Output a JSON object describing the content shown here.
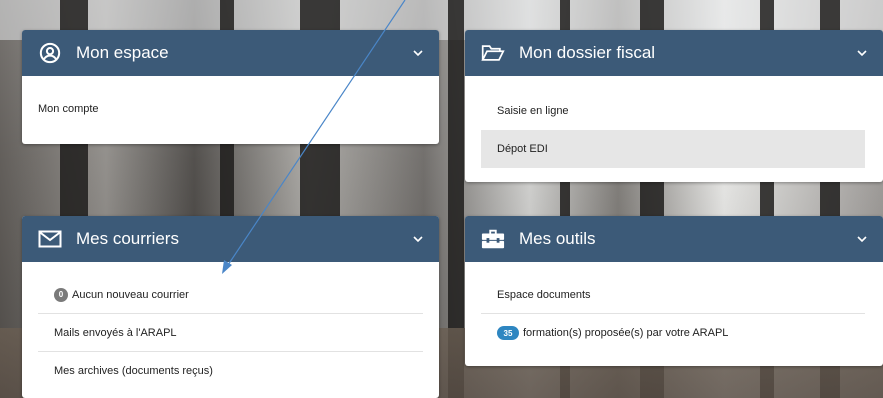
{
  "colors": {
    "header": "#3c5a78",
    "arrow": "#4a86c8",
    "badge_gray": "#7a7a7a",
    "badge_blue": "#2e86c1"
  },
  "cards": {
    "mon_espace": {
      "title": "Mon espace",
      "icon": "user-circle-icon",
      "items": [
        "Mon compte"
      ]
    },
    "mon_dossier_fiscal": {
      "title": "Mon dossier fiscal",
      "icon": "folder-open-icon",
      "items": [
        "Saisie en ligne",
        "Dépot EDI"
      ]
    },
    "mes_courriers": {
      "title": "Mes courriers",
      "icon": "envelope-icon",
      "unread_count": "0",
      "items": [
        "Aucun nouveau courrier",
        "Mails envoyés à l'ARAPL",
        "Mes archives (documents reçus)"
      ]
    },
    "mes_outils": {
      "title": "Mes outils",
      "icon": "toolbox-icon",
      "formations_count": "35",
      "items": [
        "Espace documents",
        "formation(s) proposée(s) par votre ARAPL"
      ]
    }
  }
}
